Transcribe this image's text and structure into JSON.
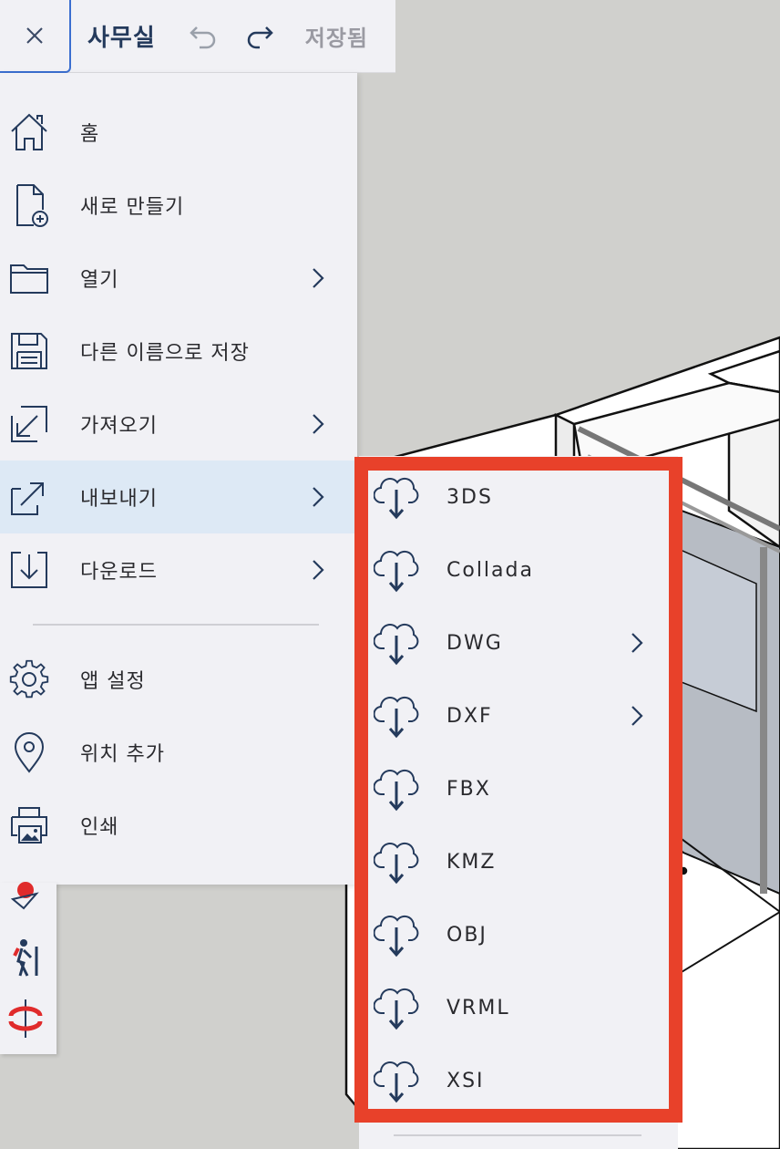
{
  "header": {
    "title": "사무실",
    "saved_status": "저장됨",
    "close_icon": "close-icon",
    "undo_icon": "undo-icon",
    "redo_icon": "redo-icon"
  },
  "menu": {
    "items": [
      {
        "label": "홈",
        "icon": "home-icon",
        "has_submenu": false
      },
      {
        "label": "새로 만들기",
        "icon": "new-file-icon",
        "has_submenu": false
      },
      {
        "label": "열기",
        "icon": "folder-icon",
        "has_submenu": true
      },
      {
        "label": "다른 이름으로 저장",
        "icon": "save-as-icon",
        "has_submenu": false
      },
      {
        "label": "가져오기",
        "icon": "import-icon",
        "has_submenu": true
      },
      {
        "label": "내보내기",
        "icon": "export-icon",
        "has_submenu": true,
        "active": true
      },
      {
        "label": "다운로드",
        "icon": "download-icon",
        "has_submenu": true
      },
      {
        "label": "앱 설정",
        "icon": "gear-icon",
        "has_submenu": false
      },
      {
        "label": "위치 추가",
        "icon": "location-pin-icon",
        "has_submenu": false
      },
      {
        "label": "인쇄",
        "icon": "print-icon",
        "has_submenu": false
      }
    ]
  },
  "export_submenu": {
    "items": [
      {
        "label": "3DS",
        "has_submenu": false
      },
      {
        "label": "Collada",
        "has_submenu": false
      },
      {
        "label": "DWG",
        "has_submenu": true
      },
      {
        "label": "DXF",
        "has_submenu": true
      },
      {
        "label": "FBX",
        "has_submenu": false
      },
      {
        "label": "KMZ",
        "has_submenu": false
      },
      {
        "label": "OBJ",
        "has_submenu": false
      },
      {
        "label": "VRML",
        "has_submenu": false
      },
      {
        "label": "XSI",
        "has_submenu": false
      }
    ],
    "item_icon": "cloud-download-icon",
    "highlight_color": "#e8412a"
  },
  "tools": [
    {
      "icon": "position-camera-icon"
    },
    {
      "icon": "walk-icon"
    },
    {
      "icon": "orbit-icon"
    }
  ],
  "colors": {
    "accent": "#243a5c",
    "active_row": "#dde9f5",
    "panel": "#f1f1f5",
    "highlight": "#e8412a"
  }
}
